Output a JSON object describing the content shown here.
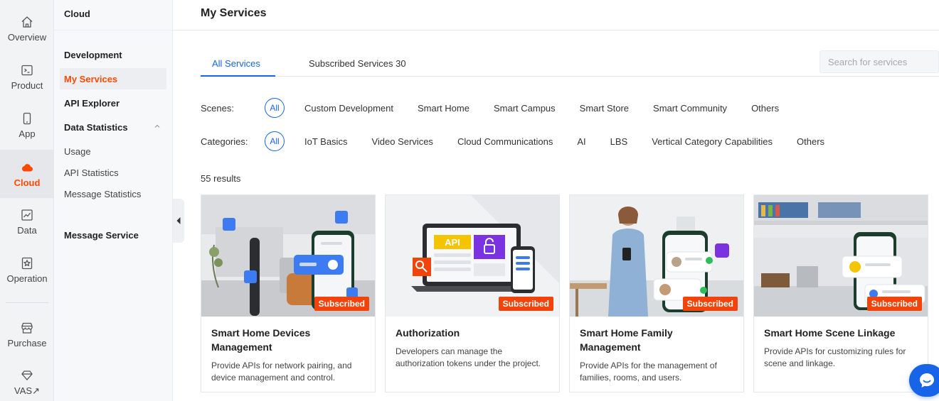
{
  "rail": {
    "items": [
      {
        "label": "Overview",
        "icon": "home-icon"
      },
      {
        "label": "Product",
        "icon": "terminal-icon"
      },
      {
        "label": "App",
        "icon": "phone-icon"
      },
      {
        "label": "Cloud",
        "icon": "cloud-icon"
      },
      {
        "label": "Data",
        "icon": "chart-icon"
      },
      {
        "label": "Operation",
        "icon": "star-doc-icon"
      },
      {
        "label": "Purchase",
        "icon": "store-icon"
      },
      {
        "label": "VAS↗",
        "icon": "diamond-icon"
      }
    ],
    "active": "Cloud",
    "accent": "#ff4800"
  },
  "sidebar": {
    "title": "Cloud",
    "items": [
      {
        "label": "Development"
      },
      {
        "label": "My Services"
      },
      {
        "label": "API Explorer"
      },
      {
        "label": "Data Statistics"
      },
      {
        "label": "Usage"
      },
      {
        "label": "API Statistics"
      },
      {
        "label": "Message Statistics"
      },
      {
        "label": "Message Service"
      }
    ]
  },
  "main": {
    "title": "My Services",
    "tabs": [
      {
        "label": "All Services"
      },
      {
        "label": "Subscribed Services 30"
      }
    ],
    "search_placeholder": "Search for services",
    "scenes": {
      "label": "Scenes:",
      "options": [
        "All",
        "Custom Development",
        "Smart Home",
        "Smart Campus",
        "Smart Store",
        "Smart Community",
        "Others"
      ]
    },
    "categories": {
      "label": "Categories:",
      "options": [
        "All",
        "IoT Basics",
        "Video Services",
        "Cloud Communications",
        "AI",
        "LBS",
        "Vertical Category Capabilities",
        "Others"
      ]
    },
    "results": "55 results",
    "cards": [
      {
        "title": "Smart Home Devices Management",
        "desc": "Provide APIs for network pairing, and device management and control.",
        "badge": "Subscribed"
      },
      {
        "title": "Authorization",
        "desc": "Developers can manage the authorization tokens under the project.",
        "badge": "Subscribed",
        "api_label": "API"
      },
      {
        "title": "Smart Home Family Management",
        "desc": "Provide APIs for the management of families, rooms, and users.",
        "badge": "Subscribed"
      },
      {
        "title": "Smart Home Scene Linkage",
        "desc": "Provide APIs for customizing rules for scene and linkage.",
        "badge": "Subscribed"
      }
    ],
    "primary_color": "#1764e8",
    "badge_color": "#f2430b"
  }
}
